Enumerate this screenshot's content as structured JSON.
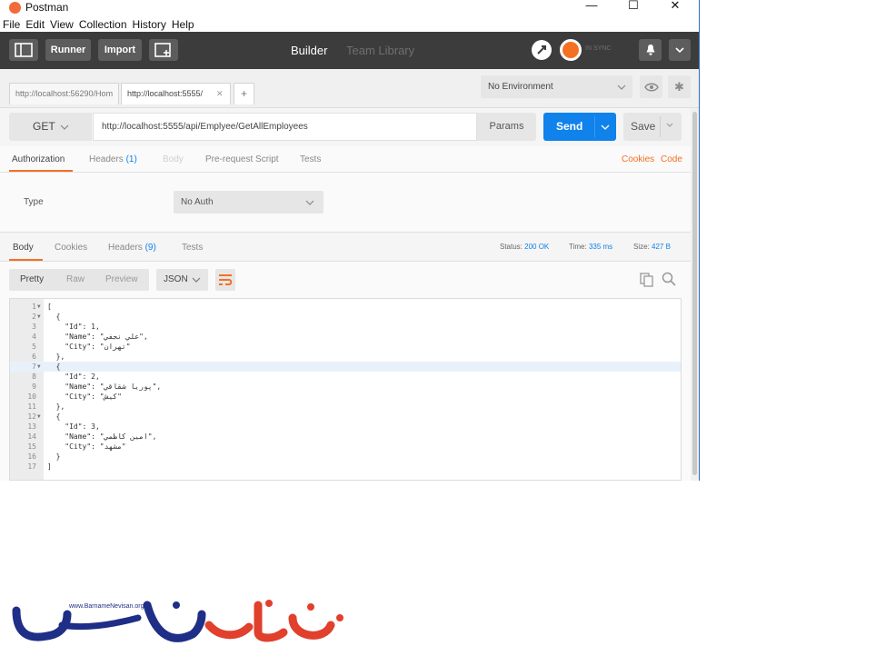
{
  "window": {
    "title": "Postman",
    "controls": {
      "minimize": "—",
      "maximize": "☐",
      "close": "✕"
    }
  },
  "menu": [
    "File",
    "Edit",
    "View",
    "Collection",
    "History",
    "Help"
  ],
  "toolbar": {
    "runner_label": "Runner",
    "import_label": "Import",
    "builder_label": "Builder",
    "team_library_label": "Team Library",
    "sync_label": "IN SYNC",
    "colors": {
      "bar": "#3c3c3c",
      "sync": "#f47023"
    }
  },
  "request_tabs": [
    {
      "label": "http://localhost:56290/Hom",
      "active": false
    },
    {
      "label": "http://localhost:5555/",
      "active": true
    }
  ],
  "new_tab_label": "+",
  "tab_close_label": "✕",
  "environment": {
    "selected": "No Environment"
  },
  "request": {
    "method": "GET",
    "url": "http://localhost:5555/api/Emplyee/GetAllEmployees",
    "params_label": "Params",
    "send_label": "Send",
    "save_label": "Save"
  },
  "request_tabs_bar": {
    "authorization": "Authorization",
    "headers": "Headers",
    "headers_count": "(1)",
    "body": "Body",
    "prerequest": "Pre-request Script",
    "tests": "Tests",
    "cookies": "Cookies",
    "code": "Code"
  },
  "auth": {
    "type_label": "Type",
    "selected": "No Auth"
  },
  "response_tabs": {
    "body": "Body",
    "cookies": "Cookies",
    "headers": "Headers",
    "headers_count": "(9)",
    "tests": "Tests"
  },
  "response_status": {
    "status_label": "Status:",
    "status_value": "200 OK",
    "time_label": "Time:",
    "time_value": "335 ms",
    "size_label": "Size:",
    "size_value": "427 B"
  },
  "view_modes": [
    "Pretty",
    "Raw",
    "Preview"
  ],
  "format": {
    "selected": "JSON"
  },
  "code_lines": [
    {
      "n": "1",
      "fold": true,
      "text": "["
    },
    {
      "n": "2",
      "fold": true,
      "text": "  {"
    },
    {
      "n": "3",
      "fold": false,
      "text": "    \"Id\": 1,"
    },
    {
      "n": "4",
      "fold": false,
      "text": "    \"Name\": \"علي نجفي\","
    },
    {
      "n": "5",
      "fold": false,
      "text": "    \"City\": \"تهران\""
    },
    {
      "n": "6",
      "fold": false,
      "text": "  },"
    },
    {
      "n": "7",
      "fold": true,
      "text": "  {"
    },
    {
      "n": "8",
      "fold": false,
      "text": "    \"Id\": 2,"
    },
    {
      "n": "9",
      "fold": false,
      "text": "    \"Name\": \"پوريا شقاقي\","
    },
    {
      "n": "10",
      "fold": false,
      "text": "    \"City\": \"کيش\""
    },
    {
      "n": "11",
      "fold": false,
      "text": "  },"
    },
    {
      "n": "12",
      "fold": true,
      "text": "  {"
    },
    {
      "n": "13",
      "fold": false,
      "text": "    \"Id\": 3,"
    },
    {
      "n": "14",
      "fold": false,
      "text": "    \"Name\": \"امين کاظمي\","
    },
    {
      "n": "15",
      "fold": false,
      "text": "    \"City\": \"مشهد\""
    },
    {
      "n": "16",
      "fold": false,
      "text": "  }"
    },
    {
      "n": "17",
      "fold": false,
      "text": "]"
    }
  ],
  "highlighted_line": "7",
  "logo": {
    "small_text": "www.BarnameNevisan.org"
  }
}
